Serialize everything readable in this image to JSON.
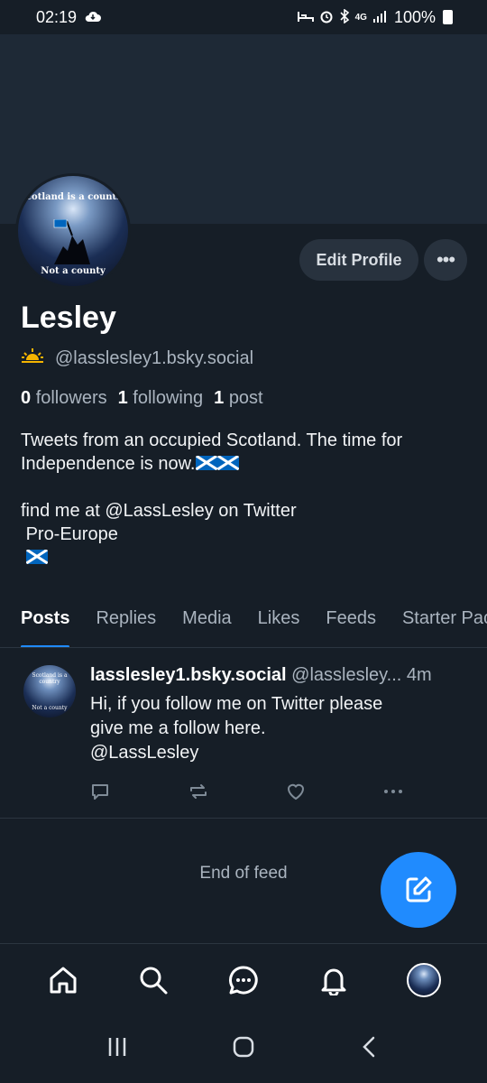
{
  "status_bar": {
    "time": "02:19",
    "network": "4G",
    "battery": "100%"
  },
  "profile": {
    "avatar_text_top": "Scotland is a country",
    "avatar_text_bottom": "Not a county",
    "edit_label": "Edit Profile",
    "more_label": "•••",
    "name": "Lesley",
    "handle": "@lasslesley1.bsky.social",
    "followers_count": "0",
    "followers_label": "followers",
    "following_count": "1",
    "following_label": "following",
    "posts_count": "1",
    "posts_label": "post",
    "bio_line1": "Tweets from an occupied Scotland. The time for",
    "bio_line2": "Independence is now.",
    "bio_line3": "find me at @LassLesley on Twitter",
    "bio_line4": " Pro-Europe"
  },
  "tabs": [
    {
      "label": "Posts",
      "active": true
    },
    {
      "label": "Replies"
    },
    {
      "label": "Media"
    },
    {
      "label": "Likes"
    },
    {
      "label": "Feeds"
    },
    {
      "label": "Starter Packs"
    }
  ],
  "post": {
    "avatar_text_top": "Scotland is a country",
    "avatar_text_bottom": "Not a county",
    "author": "lasslesley1.bsky.social",
    "handle": "@lasslesley...",
    "time": "4m",
    "text": "Hi, if you follow me on Twitter please\ngive me a follow here.\n@LassLesley"
  },
  "feed": {
    "end_label": "End of feed"
  },
  "icons": {
    "compose": "compose-icon",
    "home": "home-icon",
    "search": "search-icon",
    "chat": "chat-icon",
    "notifications": "bell-icon"
  },
  "colors": {
    "background": "#161e27",
    "banner": "#1e2936",
    "accent": "#208bfe",
    "sun": "#f5b400"
  }
}
